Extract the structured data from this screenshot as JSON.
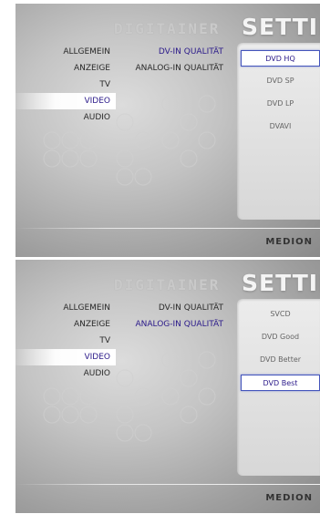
{
  "screens": [
    {
      "brand": "DIGITAINER",
      "title": "SETTINGS",
      "nav": [
        {
          "label": "ALLGEMEIN",
          "selected": false
        },
        {
          "label": "ANZEIGE",
          "selected": false
        },
        {
          "label": "TV",
          "selected": false
        },
        {
          "label": "VIDEO",
          "selected": true
        },
        {
          "label": "AUDIO",
          "selected": false
        }
      ],
      "sub": [
        {
          "label": "DV-IN QUALITÄT",
          "active": true
        },
        {
          "label": "ANALOG-IN QUALITÄT",
          "active": false
        }
      ],
      "options": [
        {
          "label": "DVD HQ",
          "selected": true
        },
        {
          "label": "DVD SP",
          "selected": false
        },
        {
          "label": "DVD LP",
          "selected": false
        },
        {
          "label": "DVAVI",
          "selected": false
        }
      ],
      "logo": "MEDION"
    },
    {
      "brand": "DIGITAINER",
      "title": "SETTINGS",
      "nav": [
        {
          "label": "ALLGEMEIN",
          "selected": false
        },
        {
          "label": "ANZEIGE",
          "selected": false
        },
        {
          "label": "TV",
          "selected": false
        },
        {
          "label": "VIDEO",
          "selected": true
        },
        {
          "label": "AUDIO",
          "selected": false
        }
      ],
      "sub": [
        {
          "label": "DV-IN QUALITÄT",
          "active": false
        },
        {
          "label": "ANALOG-IN QUALITÄT",
          "active": true
        }
      ],
      "options": [
        {
          "label": "SVCD",
          "selected": false
        },
        {
          "label": "DVD Good",
          "selected": false
        },
        {
          "label": "DVD Better",
          "selected": false
        },
        {
          "label": "DVD Best",
          "selected": true
        }
      ],
      "logo": "MEDION"
    }
  ]
}
